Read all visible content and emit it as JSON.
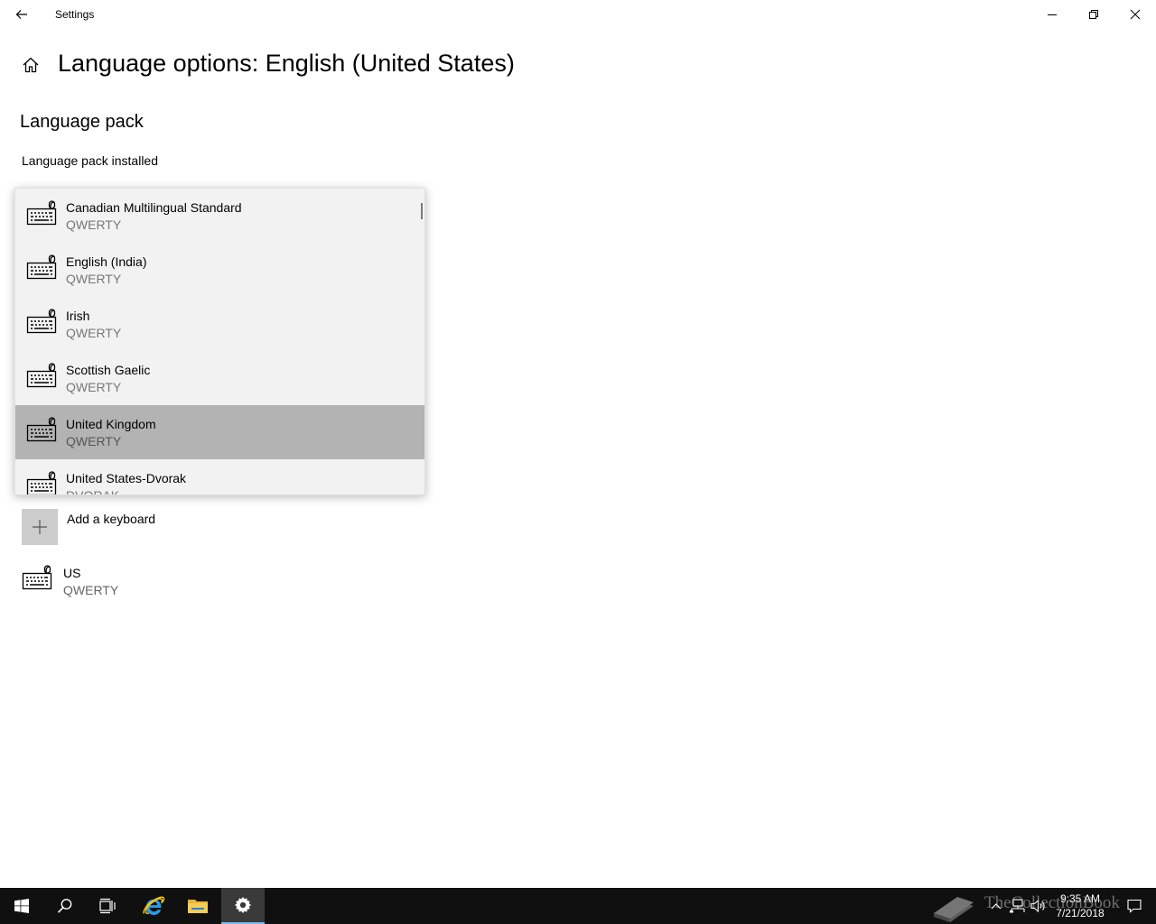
{
  "window": {
    "title": "Settings"
  },
  "page": {
    "title": "Language options: English (United States)",
    "section_language_pack": "Language pack",
    "pack_status": "Language pack installed"
  },
  "keyboards": {
    "add_label": "Add a keyboard",
    "installed": [
      {
        "name": "US",
        "layout": "QWERTY"
      }
    ]
  },
  "dropdown": {
    "items": [
      {
        "name": "Canadian Multilingual Standard",
        "layout": "QWERTY",
        "selected": false
      },
      {
        "name": "English (India)",
        "layout": "QWERTY",
        "selected": false
      },
      {
        "name": "Irish",
        "layout": "QWERTY",
        "selected": false
      },
      {
        "name": "Scottish Gaelic",
        "layout": "QWERTY",
        "selected": false
      },
      {
        "name": "United Kingdom",
        "layout": "QWERTY",
        "selected": true
      },
      {
        "name": "United States-Dvorak",
        "layout": "DVORAK",
        "selected": false
      }
    ]
  },
  "taskbar": {
    "clock_time": "9:35 AM",
    "clock_date": "7/21/2018",
    "accent_color": "#76b9ed"
  },
  "watermark": {
    "text": "TheCollectionBook"
  },
  "icons": {
    "back": "back-arrow-icon",
    "home": "home-icon",
    "minimize": "minimize-icon",
    "maximize": "restore-icon",
    "close": "close-icon",
    "keyboard": "keyboard-icon",
    "plus": "plus-icon"
  }
}
